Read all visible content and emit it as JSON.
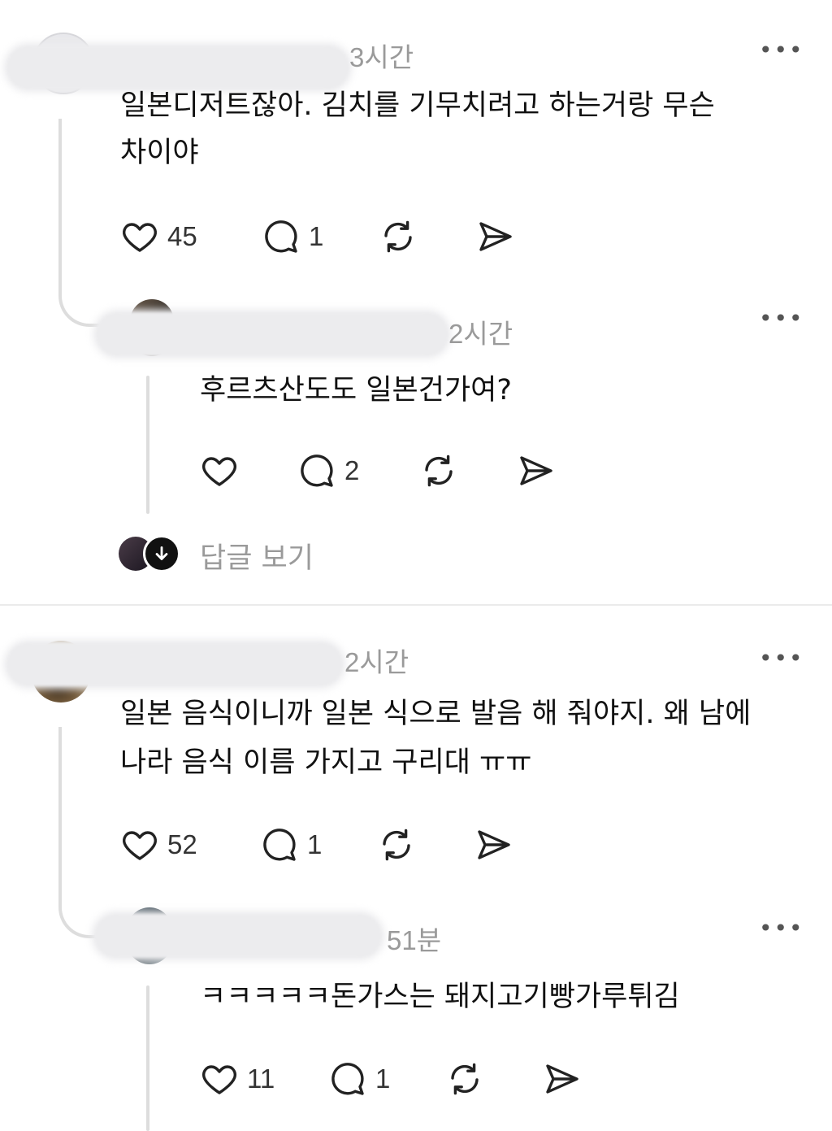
{
  "comments": [
    {
      "time": "3시간",
      "text_line1": "일본디저트잖아. 김치를 기무치려고 하는거랑 무슨",
      "text_line2": "차이야",
      "like_count": "45",
      "reply_count": "1",
      "more": "•••",
      "reply": {
        "time": "2시간",
        "text": "후르츠산도도 일본건가여?",
        "like_count": "",
        "reply_count": "2",
        "more": "•••"
      },
      "view_replies": "답글 보기"
    },
    {
      "time": "2시간",
      "text_line1": "일본 음식이니까 일본 식으로 발음 해 줘야지. 왜 남에",
      "text_line2": "나라 음식 이름 가지고 구리대 ㅠㅠ",
      "like_count": "52",
      "reply_count": "1",
      "more": "•••",
      "reply": {
        "time": "51분",
        "text": "ㅋㅋㅋㅋㅋ돈가스는 돼지고기빵가루튀김",
        "like_count": "11",
        "reply_count": "1",
        "more": "•••"
      }
    }
  ],
  "icons": [
    "heart-icon",
    "comment-icon",
    "repost-icon",
    "send-icon",
    "arrow-down-icon"
  ],
  "colors": {
    "muted": "#9a9a9a",
    "thread_line": "#dddddd",
    "text": "#111111"
  }
}
